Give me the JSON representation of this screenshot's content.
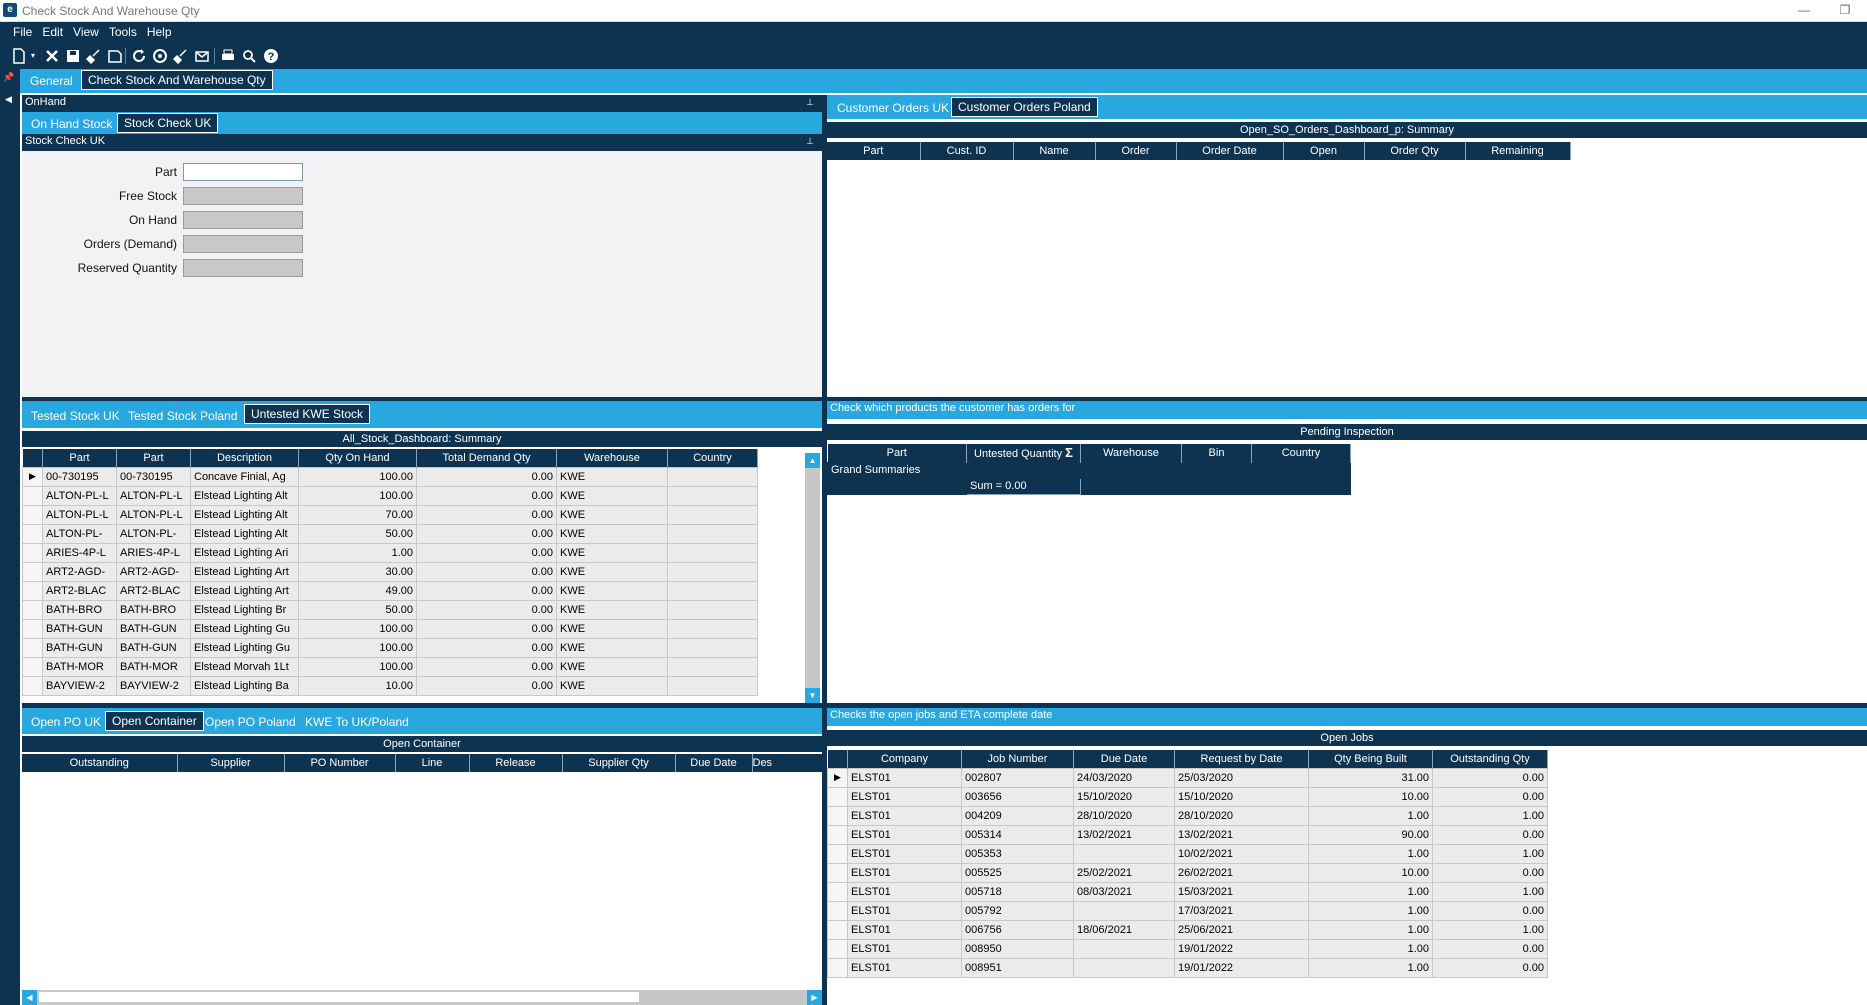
{
  "window": {
    "title": "Check Stock And Warehouse Qty"
  },
  "menu": [
    "File",
    "Edit",
    "View",
    "Tools",
    "Help"
  ],
  "outer_tabs": [
    {
      "label": "General",
      "active": false
    },
    {
      "label": "Check Stock And Warehouse Qty",
      "active": true
    }
  ],
  "onhand": {
    "header": "OnHand",
    "tabs": [
      {
        "label": "On Hand Stock",
        "active": false
      },
      {
        "label": "Stock Check UK",
        "active": true
      }
    ],
    "subheader": "Stock Check UK",
    "fields": [
      {
        "label": "Part",
        "value": "",
        "editable": true
      },
      {
        "label": "Free Stock",
        "value": "",
        "editable": false
      },
      {
        "label": "On Hand",
        "value": "",
        "editable": false
      },
      {
        "label": "Orders (Demand)",
        "value": "",
        "editable": false
      },
      {
        "label": "Reserved Quantity",
        "value": "",
        "editable": false
      }
    ]
  },
  "customer_orders": {
    "tabs": [
      {
        "label": "Customer Orders UK",
        "active": false
      },
      {
        "label": "Customer Orders Poland",
        "active": true
      }
    ],
    "grid_title": "Open_SO_Orders_Dashboard_p: Summary",
    "columns": [
      "Part",
      "Cust. ID",
      "Name",
      "Order",
      "Order Date",
      "Open",
      "Order Qty",
      "Remaining"
    ]
  },
  "stock_grid": {
    "tabs": [
      {
        "label": "Tested Stock UK",
        "active": false
      },
      {
        "label": "Tested Stock Poland",
        "active": false
      },
      {
        "label": "Untested KWE Stock",
        "active": true
      }
    ],
    "grid_title": "All_Stock_Dashboard: Summary",
    "columns": [
      "Part",
      "Part",
      "Description",
      "Qty On Hand",
      "Total Demand Qty",
      "Warehouse",
      "Country"
    ],
    "rows": [
      [
        "00-730195",
        "00-730195",
        "Concave Finial, Ag",
        "100.00",
        "0.00",
        "KWE",
        ""
      ],
      [
        "ALTON-PL-L",
        "ALTON-PL-L",
        "Elstead Lighting Alt",
        "100.00",
        "0.00",
        "KWE",
        ""
      ],
      [
        "ALTON-PL-L",
        "ALTON-PL-L",
        "Elstead Lighting Alt",
        "70.00",
        "0.00",
        "KWE",
        ""
      ],
      [
        "ALTON-PL-",
        "ALTON-PL-",
        "Elstead Lighting Alt",
        "50.00",
        "0.00",
        "KWE",
        ""
      ],
      [
        "ARIES-4P-L",
        "ARIES-4P-L",
        "Elstead Lighting Ari",
        "1.00",
        "0.00",
        "KWE",
        ""
      ],
      [
        "ART2-AGD-",
        "ART2-AGD-",
        "Elstead Lighting Art",
        "30.00",
        "0.00",
        "KWE",
        ""
      ],
      [
        "ART2-BLAC",
        "ART2-BLAC",
        "Elstead Lighting Art",
        "49.00",
        "0.00",
        "KWE",
        ""
      ],
      [
        "BATH-BRO",
        "BATH-BRO",
        "Elstead Lighting Br",
        "50.00",
        "0.00",
        "KWE",
        ""
      ],
      [
        "BATH-GUN",
        "BATH-GUN",
        "Elstead Lighting Gu",
        "100.00",
        "0.00",
        "KWE",
        ""
      ],
      [
        "BATH-GUN",
        "BATH-GUN",
        "Elstead Lighting Gu",
        "100.00",
        "0.00",
        "KWE",
        ""
      ],
      [
        "BATH-MOR",
        "BATH-MOR",
        "Elstead Morvah 1Lt",
        "100.00",
        "0.00",
        "KWE",
        ""
      ],
      [
        "BAYVIEW-2",
        "BAYVIEW-2",
        "Elstead Lighting Ba",
        "10.00",
        "0.00",
        "KWE",
        ""
      ]
    ]
  },
  "pending": {
    "header": "Check which products the customer has orders for",
    "grid_title": "Pending Inspection",
    "columns": [
      "Part",
      "Untested Quantity",
      "Warehouse",
      "Bin",
      "Country"
    ],
    "sigma": "Σ",
    "group_label": "Grand Summaries",
    "sum_label": "Sum = 0.00"
  },
  "po": {
    "tabs": [
      {
        "label": "Open PO UK",
        "active": false
      },
      {
        "label": "Open Container",
        "active": true
      },
      {
        "label": "Open PO Poland",
        "active": false
      },
      {
        "label": "KWE To UK/Poland",
        "active": false
      }
    ],
    "grid_title": "Open Container",
    "columns": [
      "Outstanding",
      "Supplier",
      "PO Number",
      "Line",
      "Release",
      "Supplier Qty",
      "Due Date",
      "Des"
    ]
  },
  "jobs": {
    "header": "Checks the open jobs and ETA complete date",
    "grid_title": "Open Jobs",
    "columns": [
      "Company",
      "Job Number",
      "Due Date",
      "Request by Date",
      "Qty Being Built",
      "Outstanding Qty"
    ],
    "rows": [
      [
        "ELST01",
        "002807",
        "24/03/2020",
        "25/03/2020",
        "31.00",
        "0.00"
      ],
      [
        "ELST01",
        "003656",
        "15/10/2020",
        "15/10/2020",
        "10.00",
        "0.00"
      ],
      [
        "ELST01",
        "004209",
        "28/10/2020",
        "28/10/2020",
        "1.00",
        "1.00"
      ],
      [
        "ELST01",
        "005314",
        "13/02/2021",
        "13/02/2021",
        "90.00",
        "0.00"
      ],
      [
        "ELST01",
        "005353",
        "",
        "10/02/2021",
        "1.00",
        "1.00"
      ],
      [
        "ELST01",
        "005525",
        "25/02/2021",
        "26/02/2021",
        "10.00",
        "0.00"
      ],
      [
        "ELST01",
        "005718",
        "08/03/2021",
        "15/03/2021",
        "1.00",
        "1.00"
      ],
      [
        "ELST01",
        "005792",
        "",
        "17/03/2021",
        "1.00",
        "0.00"
      ],
      [
        "ELST01",
        "006756",
        "18/06/2021",
        "25/06/2021",
        "1.00",
        "1.00"
      ],
      [
        "ELST01",
        "008950",
        "",
        "19/01/2022",
        "1.00",
        "0.00"
      ],
      [
        "ELST01",
        "008951",
        "",
        "19/01/2022",
        "1.00",
        "0.00"
      ]
    ]
  }
}
